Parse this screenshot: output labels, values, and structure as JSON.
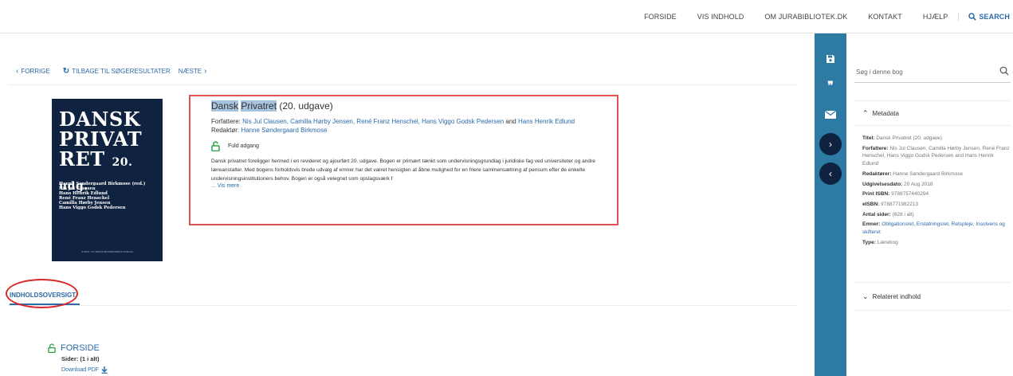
{
  "topnav": {
    "items": [
      "FORSIDE",
      "VIS INDHOLD",
      "OM JURABIBLIOTEK.DK",
      "KONTAKT",
      "HJÆLP"
    ],
    "search_label": "SEARCH"
  },
  "breadcrumb": {
    "prev": "FORRIGE",
    "back": "TILBAGE TIL SØGERESULTATER",
    "next": "NÆSTE"
  },
  "cover": {
    "title_line1": "DANSK",
    "title_line2": "PRIVAT",
    "title_line3": "RET",
    "edition": "20. udg.",
    "authors": [
      "Hanne Søndergaard Birkmose (red.)",
      "Nis Jul Clausen",
      "Hans Henrik Edlund",
      "René Franz Henschel",
      "Camilla Hørby Jensen",
      "Hans Viggo Godsk Pedersen"
    ],
    "publisher": "JURIST- OG ØKONOMFORBUNDETS FORLAG"
  },
  "book": {
    "title_word1": "Dansk",
    "title_word2": "Privatret",
    "title_rest": " (20. udgave)",
    "authors_label": "Forfattere:",
    "authors": "Nis Jul Clausen, Camilla Hørby Jensen, René Franz Henschel, Hans Viggo Godsk Pedersen",
    "authors_and": "and",
    "authors_last": "Hans Henrik Edlund",
    "editor_label": "Redaktør:",
    "editor": "Hanne Søndergaard Birkmose",
    "access": "Fuld adgang",
    "description": "Dansk privatret foreligger hermed i en revideret og ajourført 20. udgave. Bogen er primært tænkt som undervisningsgrundlag i juridiske fag ved universiteter og andre læreanstalter. Med bogens forholdsvis brede udvalg af emner har det været hensigten at åbne mulighed for en friere sammensætning af pensum efter de enkelte undervisningsinstitutioners behov. Bogen er også velegnet som opslagsværk f",
    "more": "... Vis mere"
  },
  "tabs": {
    "toc": "INDHOLDSOVERSIGT"
  },
  "toc": {
    "title": "FORSIDE",
    "pages": "Sider: (1 i alt)",
    "download": "Download PDF"
  },
  "panel": {
    "search_placeholder": "Søg i denne bog",
    "metadata_label": "Metadata",
    "related_label": "Relateret indhold",
    "meta": {
      "title_label": "Titel:",
      "title": "Dansk Privatret (20. udgave)",
      "authors_label": "Forfattere:",
      "authors": "Nis Jul Clausen, Camilla Hørby Jensen, René Franz Henschel, Hans Viggo Godsk Pedersen and Hans Henrik Edlund",
      "editors_label": "Redaktører:",
      "editors": "Hanne Søndergaard Birkmose",
      "date_label": "Udgivelsesdato:",
      "date": "20 Aug 2018",
      "print_isbn_label": "Print ISBN:",
      "print_isbn": "9788757440294",
      "eisbn_label": "eISBN:",
      "eisbn": "9788771982213",
      "pages_label": "Antal sider:",
      "pages": "(828 i alt)",
      "subjects_label": "Emner:",
      "subjects": "Obligationsret, Erstatningsret, Retspleje, Insolvens og skifteret",
      "type_label": "Type:",
      "type": "Lærebog"
    }
  },
  "colors": {
    "accent": "#2b6aa8",
    "toolbar": "#2d7aa3",
    "dark": "#0f2340",
    "highlight_box": "#e35252",
    "lock": "#2fa34a"
  }
}
